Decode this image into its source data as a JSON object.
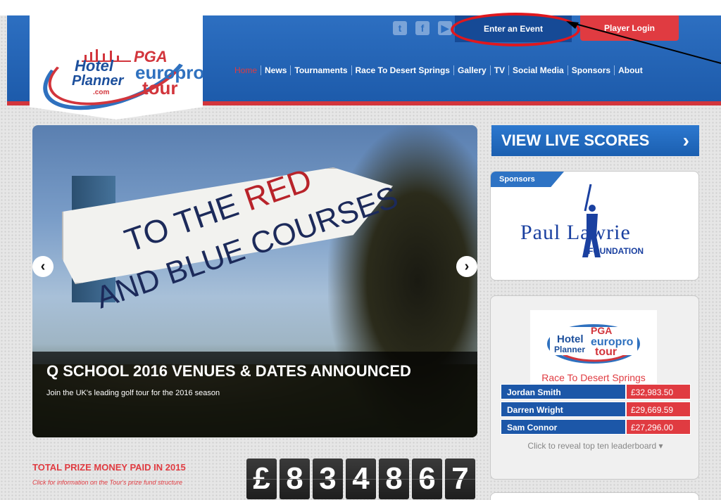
{
  "header": {
    "social": [
      "twitter-icon",
      "facebook-icon",
      "youtube-icon"
    ],
    "enter_event": "Enter an Event",
    "player_login": "Player Login",
    "logo": {
      "hotel": "Hotel",
      "planner": "Planner",
      "com": ".com",
      "pga": "PGA",
      "europro": "europro",
      "tour": "tour"
    },
    "nav": [
      "Home",
      "News",
      "Tournaments",
      "Race To Desert Springs",
      "Gallery",
      "TV",
      "Social Media",
      "Sponsors",
      "About"
    ]
  },
  "slider": {
    "sign_line1_a": "TO THE ",
    "sign_line1_b": "RED",
    "sign_line2": "AND BLUE COURSES",
    "headline": "Q SCHOOL 2016 VENUES & DATES ANNOUNCED",
    "subtext": "Join the UK's leading golf tour for the 2016 season",
    "prev": "‹",
    "next": "›"
  },
  "prize": {
    "title": "TOTAL PRIZE MONEY PAID IN 2015",
    "subtitle": "Click for information on the Tour's prize fund structure",
    "digits": [
      "£",
      "8",
      "3",
      "4",
      "8",
      "6",
      "7"
    ]
  },
  "sidebar": {
    "live_scores": "VIEW LIVE SCORES",
    "live_chevron": "›",
    "sponsors_label": "Sponsors",
    "sponsor_name": "Paul Lawrie",
    "sponsor_sub": "FOUNDATION",
    "race_title": "Race To Desert Springs",
    "leaderboard": [
      {
        "name": "Jordan Smith",
        "amount": "£32,983.50"
      },
      {
        "name": "Darren Wright",
        "amount": "£29,669.59"
      },
      {
        "name": "Sam Connor",
        "amount": "£27,296.00"
      }
    ],
    "reveal": "Click to reveal top ten leaderboard ▾"
  },
  "colors": {
    "brand_blue": "#2d6fc1",
    "brand_red": "#e03b41",
    "annotation_red": "#e0181e"
  }
}
